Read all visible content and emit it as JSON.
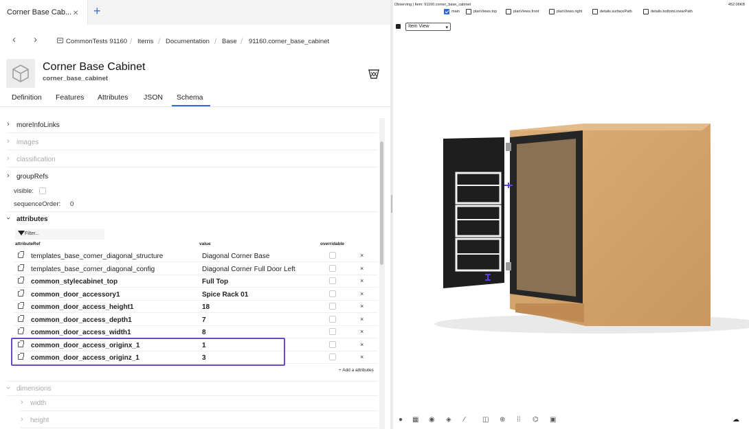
{
  "tab": {
    "label": "Corner Base Cab...",
    "close_glyph": "×",
    "new_glyph": "+"
  },
  "breadcrumb": {
    "back_glyph": "‹",
    "forward_glyph": "›",
    "items": [
      "CommonTests 91160",
      "Items",
      "Documentation",
      "Base",
      "91160.corner_base_cabinet"
    ],
    "separator": "/"
  },
  "header": {
    "title": "Corner Base Cabinet",
    "subtitle": "corner_base_cabinet",
    "thumb_icon": "cube-icon",
    "action_icon": "basket-icon"
  },
  "tabs": [
    "Definition",
    "Features",
    "Attributes",
    "JSON",
    "Schema"
  ],
  "active_tab": "Schema",
  "schema": {
    "more_info_links": "moreInfoLinks",
    "images": "images",
    "classification": "classification",
    "group_refs": "groupRefs",
    "visible_label": "visible:",
    "sequence_order_label": "sequenceOrder:",
    "sequence_order_value": "0",
    "attributes_label": "attributes",
    "filter_placeholder": "Filter...",
    "col_attribute_ref": "attributeRef",
    "col_value": "value",
    "col_overridable": "overridable",
    "add_attributes": "+ Add a attributes",
    "dimensions": "dimensions",
    "width": "width",
    "height": "height"
  },
  "attributes": [
    {
      "ref": "templates_base_corner_diagonal_structure",
      "value": "Diagonal Corner Base",
      "bold": false
    },
    {
      "ref": "templates_base_corner_diagonal_config",
      "value": "Diagonal Corner Full Door Left",
      "bold": false
    },
    {
      "ref": "common_stylecabinet_top",
      "value": "Full Top",
      "bold": true
    },
    {
      "ref": "common_door_accessory1",
      "value": "Spice Rack 01",
      "bold": true
    },
    {
      "ref": "common_door_access_height1",
      "value": "18",
      "bold": true
    },
    {
      "ref": "common_door_access_depth1",
      "value": "7",
      "bold": true
    },
    {
      "ref": "common_door_access_width1",
      "value": "8",
      "bold": true
    },
    {
      "ref": "common_door_access_originx_1",
      "value": "1",
      "bold": true
    },
    {
      "ref": "common_door_access_originz_1",
      "value": "3",
      "bold": true
    }
  ],
  "remove_glyph": "×",
  "viewer": {
    "observing": "Observing | Item: 91160.corner_base_cabinet",
    "size": "452.06KB",
    "views": [
      {
        "label": "main",
        "checked": true
      },
      {
        "label": "planViews.top",
        "checked": false
      },
      {
        "label": "planViews.front",
        "checked": false
      },
      {
        "label": "planViews.right",
        "checked": false
      },
      {
        "label": "details.surfacePath",
        "checked": false
      },
      {
        "label": "details.bottomLinearPath",
        "checked": false
      }
    ],
    "view_select": "Item View",
    "toolbar_icons": [
      "palette-icon",
      "grid-icon",
      "compass-icon",
      "box-icon",
      "brush-icon",
      "frame-icon",
      "target-icon",
      "dots-grid-icon",
      "hierarchy-icon",
      "image-icon"
    ],
    "cloud_icon": "cloud-download-icon"
  },
  "colors": {
    "accent": "#2e6bd8",
    "highlight": "#6a48c9",
    "door": "#2a2a2a",
    "wood": "#d2a26c"
  }
}
